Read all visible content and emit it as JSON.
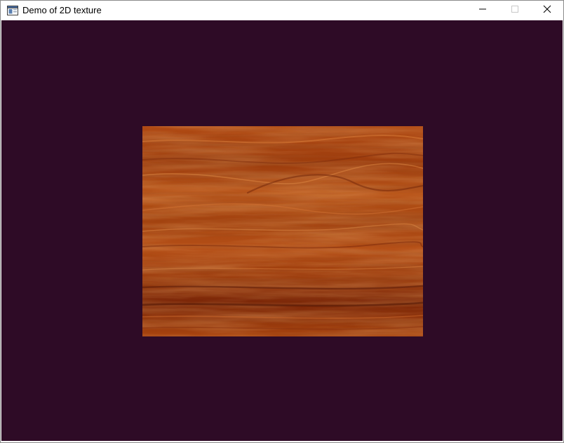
{
  "window": {
    "title": "Demo of 2D texture",
    "app_icon": "opengl-app-icon",
    "controls": {
      "minimize_icon": "minimize-icon",
      "maximize_icon": "maximize-icon",
      "close_icon": "close-icon"
    }
  },
  "viewport": {
    "clear_color": "#2e0b26",
    "texture": {
      "pattern": "wood-grain",
      "base_color": "#a8440f",
      "light_color": "#d46f2a",
      "dark_color": "#6a1f08"
    }
  }
}
